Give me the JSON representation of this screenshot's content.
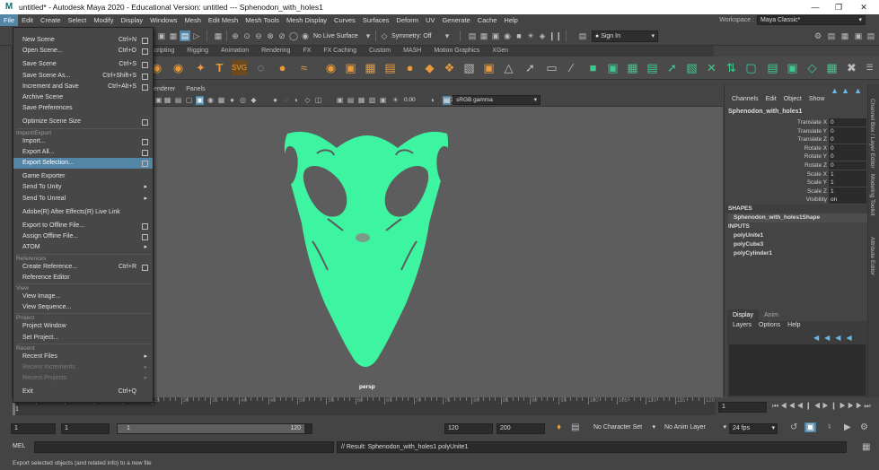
{
  "window": {
    "title": "untitled* - Autodesk Maya 2020 - Educational Version: untitled   ---   Sphenodon_with_holes1"
  },
  "menubar": {
    "items": [
      "File",
      "Edit",
      "Create",
      "Select",
      "Modify",
      "Display",
      "Windows",
      "Mesh",
      "Edit Mesh",
      "Mesh Tools",
      "Mesh Display",
      "Curves",
      "Surfaces",
      "Deform",
      "UV",
      "Generate",
      "Cache",
      "Help"
    ],
    "workspace_label": "Workspace :",
    "workspace_value": "Maya Classic*"
  },
  "statusline": {
    "live_surface": "No Live Surface",
    "symmetry": "Symmetry: Off",
    "sign_in": "Sign In"
  },
  "shelf": {
    "tabs": [
      "Scripting",
      "Rigging",
      "Animation",
      "Rendering",
      "FX",
      "FX Caching",
      "Custom",
      "MASH",
      "Motion Graphics",
      "XGen"
    ]
  },
  "viewport": {
    "menus": [
      "Renderer",
      "Panels"
    ],
    "exposure": "0.00",
    "gamma": "1.00",
    "color_space": "sRGB gamma",
    "camera_label": "persp",
    "mesh_color": "#3df5a0"
  },
  "file_menu": {
    "items": [
      {
        "label": "New Scene",
        "shortcut": "Ctrl+N",
        "option": true
      },
      {
        "label": "Open Scene...",
        "shortcut": "Ctrl+O",
        "option": true
      },
      {
        "label": "Save Scene",
        "shortcut": "Ctrl+S",
        "option": true
      },
      {
        "label": "Save Scene As...",
        "shortcut": "Ctrl+Shift+S",
        "option": true
      },
      {
        "label": "Increment and Save",
        "shortcut": "Ctrl+Alt+S",
        "option": true
      },
      {
        "label": "Archive Scene",
        "shortcut": "",
        "option": false
      },
      {
        "label": "Save Preferences",
        "shortcut": "",
        "option": false
      },
      {
        "label": "Optimize Scene Size",
        "shortcut": "",
        "option": true
      },
      {
        "label": "Import...",
        "shortcut": "",
        "option": true
      },
      {
        "label": "Export All...",
        "shortcut": "",
        "option": true
      },
      {
        "label": "Export Selection...",
        "shortcut": "",
        "option": true
      },
      {
        "label": "Game Exporter",
        "shortcut": "",
        "option": false
      },
      {
        "label": "Send To Unity",
        "shortcut": "",
        "submenu": true
      },
      {
        "label": "Send To Unreal",
        "shortcut": "",
        "submenu": true
      },
      {
        "label": "Adobe(R) After Effects(R) Live Link",
        "shortcut": "",
        "option": false
      },
      {
        "label": "Export to Offline File...",
        "shortcut": "",
        "option": true
      },
      {
        "label": "Assign Offline File...",
        "shortcut": "",
        "option": true
      },
      {
        "label": "ATOM",
        "shortcut": "",
        "submenu": true
      },
      {
        "label": "Create Reference...",
        "shortcut": "Ctrl+R",
        "option": true
      },
      {
        "label": "Reference Editor",
        "shortcut": "",
        "option": false
      },
      {
        "label": "View Image...",
        "shortcut": "",
        "option": false
      },
      {
        "label": "View Sequence...",
        "shortcut": "",
        "option": false
      },
      {
        "label": "Project Window",
        "shortcut": "",
        "option": false
      },
      {
        "label": "Set Project...",
        "shortcut": "",
        "option": false
      },
      {
        "label": "Recent Files",
        "shortcut": "",
        "submenu": true
      },
      {
        "label": "Recent Increments",
        "shortcut": "",
        "submenu": true
      },
      {
        "label": "Recent Projects",
        "shortcut": "",
        "submenu": true
      },
      {
        "label": "Exit",
        "shortcut": "Ctrl+Q",
        "option": false
      }
    ],
    "sections": [
      "Import/Export",
      "References",
      "View",
      "Project",
      "Recent"
    ]
  },
  "channel_box": {
    "tabs": [
      "Channels",
      "Edit",
      "Object",
      "Show"
    ],
    "object_name": "Sphenodon_with_holes1",
    "attributes": [
      {
        "name": "Translate X",
        "value": "0"
      },
      {
        "name": "Translate Y",
        "value": "0"
      },
      {
        "name": "Translate Z",
        "value": "0"
      },
      {
        "name": "Rotate X",
        "value": "0"
      },
      {
        "name": "Rotate Y",
        "value": "0"
      },
      {
        "name": "Rotate Z",
        "value": "0"
      },
      {
        "name": "Scale X",
        "value": "1"
      },
      {
        "name": "Scale Y",
        "value": "1"
      },
      {
        "name": "Scale Z",
        "value": "1"
      },
      {
        "name": "Visibility",
        "value": "on"
      }
    ],
    "shapes_label": "SHAPES",
    "shape_name": "Sphenodon_with_holes1Shape",
    "inputs_label": "INPUTS",
    "inputs": [
      "polyUnite1",
      "polyCube3",
      "polyCylinder1"
    ],
    "side_tabs": [
      "Channel Box / Layer Editor",
      "Modeling Toolkit",
      "Attribute Editor"
    ]
  },
  "layer_editor": {
    "tabs": [
      "Display",
      "Anim"
    ],
    "menus": [
      "Layers",
      "Options",
      "Help"
    ]
  },
  "time_slider": {
    "ticks": [
      "5",
      "10",
      "15",
      "20",
      "25",
      "30",
      "35",
      "40",
      "45",
      "50",
      "55",
      "60",
      "65",
      "70",
      "75",
      "80",
      "85",
      "90",
      "95",
      "100",
      "105",
      "110",
      "115",
      "120"
    ],
    "current_frame": "1",
    "frame_field": "1"
  },
  "range_slider": {
    "start": "1",
    "playback_start": "1",
    "range_start_label": "1",
    "range_end_label": "120",
    "playback_end": "120",
    "end": "200",
    "character_set": "No Character Set",
    "anim_layer": "No Anim Layer",
    "fps": "24 fps"
  },
  "command_line": {
    "mode": "MEL",
    "result": "// Result: Sphenodon_with_holes1 polyUnite1"
  },
  "help_line": "Export selected objects (and related info) to a new file"
}
